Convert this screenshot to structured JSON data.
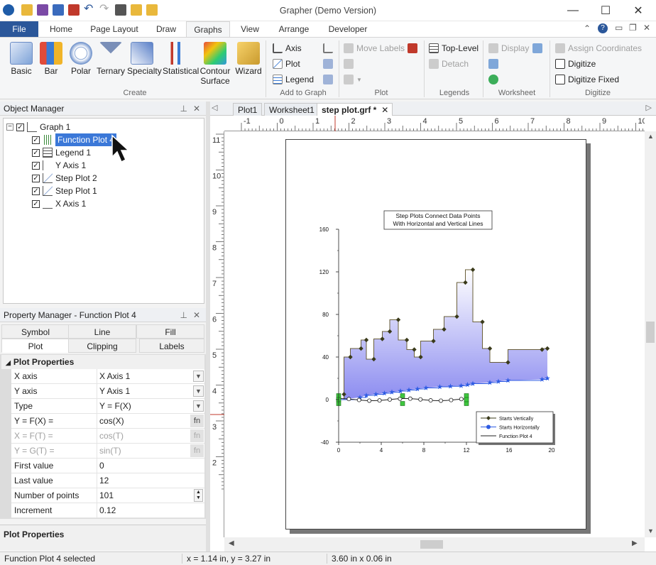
{
  "window": {
    "title": "Grapher (Demo Version)"
  },
  "ribbon_tabs": [
    "File",
    "Home",
    "Page Layout",
    "Draw",
    "Graphs",
    "View",
    "Arrange",
    "Developer"
  ],
  "create_group": {
    "label": "Create",
    "buttons": [
      "Basic",
      "Bar",
      "Polar",
      "Ternary",
      "Specialty",
      "Statistical",
      "Contour\nSurface",
      "Wizard"
    ]
  },
  "add_to_graph": {
    "label": "Add to Graph",
    "axis": "Axis",
    "plot": "Plot",
    "legend": "Legend"
  },
  "plot_group": {
    "label": "Plot",
    "move_labels": "Move Labels"
  },
  "legends_group": {
    "label": "Legends",
    "top_level": "Top-Level",
    "detach": "Detach"
  },
  "worksheet_group": {
    "label": "Worksheet",
    "display": "Display"
  },
  "digitize_group": {
    "label": "Digitize",
    "assign": "Assign Coordinates",
    "digitize": "Digitize",
    "digitize_fixed": "Digitize Fixed"
  },
  "object_manager": {
    "title": "Object Manager",
    "items": [
      "Graph 1",
      "Function Plot 4",
      "Legend 1",
      "Y Axis 1",
      "Step Plot 2",
      "Step Plot 1",
      "X Axis 1"
    ]
  },
  "property_manager": {
    "title": "Property Manager - Function Plot 4",
    "tabs": [
      "Symbol",
      "Line",
      "Fill",
      "Plot",
      "Clipping",
      "Labels"
    ],
    "section": "Plot Properties",
    "rows": [
      {
        "key": "X axis",
        "value": "X Axis 1"
      },
      {
        "key": "Y axis",
        "value": "Y Axis 1"
      },
      {
        "key": "Type",
        "value": "Y = F(X)"
      },
      {
        "key": "Y = F(X) =",
        "value": "cos(X)"
      },
      {
        "key": "X = F(T) =",
        "value": "cos(T)"
      },
      {
        "key": "Y = G(T) =",
        "value": "sin(T)"
      },
      {
        "key": "First value",
        "value": "0"
      },
      {
        "key": "Last value",
        "value": "12"
      },
      {
        "key": "Number of points",
        "value": "101"
      },
      {
        "key": "Increment",
        "value": "0.12"
      }
    ],
    "fn_label": "fn",
    "footer": "Plot Properties"
  },
  "doc_tabs": [
    "Plot1",
    "Worksheet1",
    "step plot.grf *"
  ],
  "ruler": {
    "h": [
      "-1",
      "0",
      "1",
      "2",
      "3",
      "4",
      "5",
      "6",
      "7",
      "8",
      "9",
      "10"
    ],
    "v": [
      "11",
      "10",
      "9",
      "8",
      "7",
      "6",
      "5",
      "4",
      "3",
      "2"
    ]
  },
  "status": {
    "selected": "Function Plot 4 selected",
    "coords": "x = 1.14 in, y = 3.27 in",
    "size": "3.60 in x 0.06 in"
  },
  "chart_data": {
    "type": "line",
    "title": "Step Plots Connect Data Points\nWith Horizontal and Vertical Lines",
    "xlim": [
      0,
      20
    ],
    "ylim": [
      -40,
      160
    ],
    "x_ticks": [
      0,
      4,
      8,
      12,
      16,
      20
    ],
    "y_ticks": [
      -40,
      0,
      40,
      80,
      120,
      160
    ],
    "series": [
      {
        "name": "Starts Vertically",
        "color": "#3a3a1a",
        "marker": "diamond",
        "x": [
          0.5,
          1.1,
          2.1,
          2.6,
          3.3,
          4.1,
          4.8,
          5.6,
          6.4,
          7.1,
          7.7,
          8.9,
          9.9,
          11.1,
          11.9,
          12.6,
          13.5,
          14.2,
          15.9,
          19.1,
          19.6
        ],
        "y": [
          5,
          40,
          48,
          56,
          38,
          57,
          64,
          75,
          56,
          47,
          40,
          55,
          66,
          78,
          110,
          122,
          73,
          48,
          35,
          47,
          48
        ]
      },
      {
        "name": "Starts Horizontally",
        "color": "#2d5be3",
        "marker": "star",
        "x": [
          0,
          2,
          2.6,
          3.5,
          4.3,
          5,
          5.8,
          6.6,
          7.4,
          8.2,
          9.5,
          10.5,
          11.5,
          12.1,
          12.6,
          14.2,
          15,
          15.9,
          19.1,
          19.6
        ],
        "y": [
          0,
          2,
          4,
          5,
          6,
          7,
          8,
          9,
          10,
          11,
          12,
          12.5,
          13,
          14,
          15,
          16,
          17,
          18,
          19,
          20
        ]
      },
      {
        "name": "Function Plot 4",
        "color": "#222222",
        "marker": "circle"
      }
    ],
    "function_plot": {
      "expr": "cos(X)",
      "first": 0,
      "last": 12,
      "points": 101
    }
  }
}
